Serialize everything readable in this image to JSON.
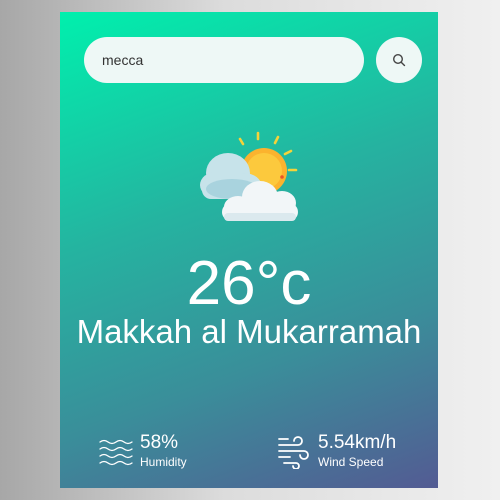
{
  "search": {
    "value": "mecca",
    "button_icon": "search-icon"
  },
  "weather": {
    "icon": "partly-cloudy-sun-icon",
    "temperature": "26°c",
    "city": "Makkah al Mukarramah"
  },
  "details": {
    "humidity": {
      "icon": "humidity-waves-icon",
      "value": "58%",
      "label": "Humidity"
    },
    "wind": {
      "icon": "wind-icon",
      "value": "5.54km/h",
      "label": "Wind Speed"
    }
  },
  "colors": {
    "card_gradient_top": "#00f0ad",
    "card_gradient_bottom": "#535b93",
    "search_bg": "#eef8f6",
    "text": "#ffffff"
  }
}
